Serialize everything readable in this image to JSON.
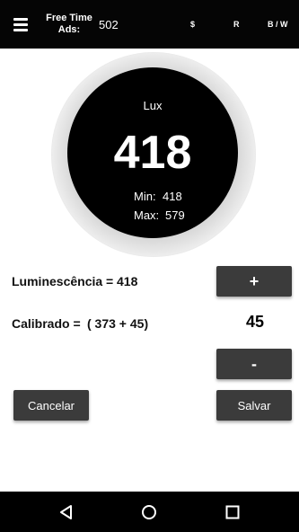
{
  "topbar": {
    "menu_icon": "hamburger-menu-icon",
    "ads_label_line1": "Free Time",
    "ads_label_line2": "Ads:",
    "ads_value": "502",
    "action_dollar": "$",
    "action_r": "R",
    "action_bw": "B / W",
    "background_color": "#050505"
  },
  "gauge": {
    "unit": "Lux",
    "value": "418",
    "min_label": "Min:",
    "min_value": "418",
    "max_label": "Max:",
    "max_value": "579"
  },
  "calibration": {
    "luminescence_label": "Luminescência =",
    "luminescence_value": "418",
    "calibrated_label": "Calibrado =",
    "calibrated_formula": "( 373 + 45)",
    "offset_value": "45",
    "plus_label": "+",
    "minus_label": "-"
  },
  "actions": {
    "cancel_label": "Cancelar",
    "save_label": "Salvar",
    "button_color": "#3b3b3b"
  },
  "navbar": {
    "back_icon": "back-triangle-icon",
    "home_icon": "home-circle-icon",
    "recent_icon": "recent-apps-square-icon"
  }
}
